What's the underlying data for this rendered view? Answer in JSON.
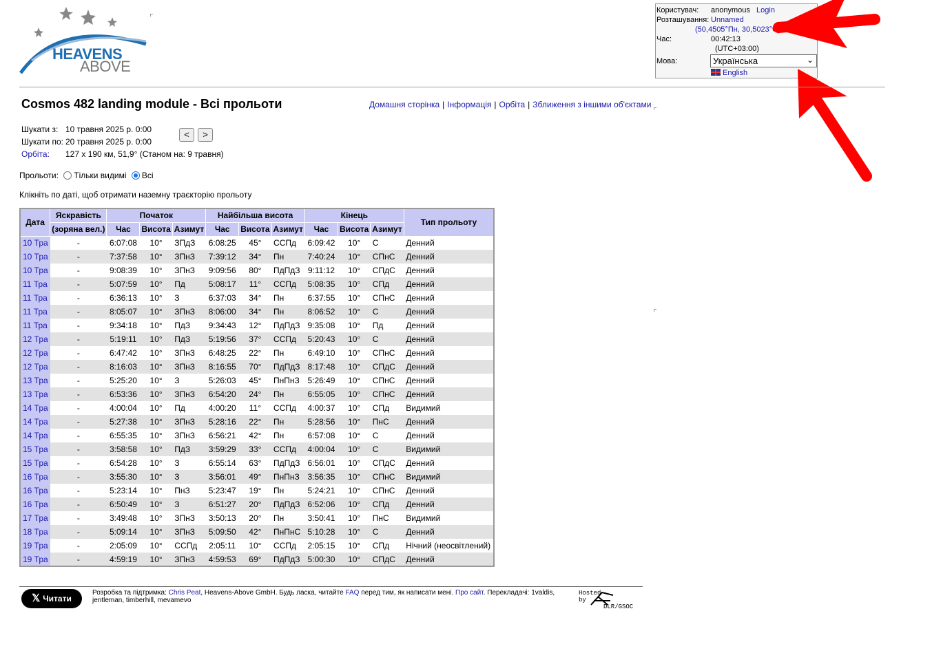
{
  "logo": {
    "line1": "HEAVENS",
    "line2": "ABOVE"
  },
  "userbox": {
    "user_label": "Користувач:",
    "user_value": "anonymous",
    "login_link": "Login",
    "location_label": "Розташування:",
    "location_name": "Unnamed",
    "location_coords": "(50,4505°Пн, 30,5023°С)",
    "time_label": "Час:",
    "time_value": "00:42:13",
    "timezone": "(UTC+03:00)",
    "language_label": "Мова:",
    "language_selected": "Українська",
    "english_link": "English"
  },
  "title": "Cosmos 482 landing module - Всі прольоти",
  "topnav": {
    "home": "Домашня сторінка",
    "info": "Інформація",
    "orbit": "Орбіта",
    "close": "Зближення з іншими об'єктами"
  },
  "params": {
    "from_label": "Шукати з:",
    "from_value": "10 травня 2025 р. 0:00",
    "to_label": "Шукати по:",
    "to_value": "20 травня 2025 р. 0:00",
    "orbit_label": "Орбіта:",
    "orbit_value": "127 x 190 км, 51,9° (Станом на: 9 травня)",
    "prev": "<",
    "next": ">"
  },
  "filter": {
    "label": "Прольоти:",
    "visible_only": "Тільки видимі",
    "all": "Всі"
  },
  "hint": "Клікніть по даті, щоб отримати наземну траєкторію прольоту",
  "table": {
    "headers": {
      "date": "Дата",
      "brightness": "Яскравість",
      "brightness_sub": "(зоряна вел.)",
      "start": "Початок",
      "highest": "Найбільша висота",
      "end": "Кінець",
      "type": "Тип прольоту",
      "time": "Час",
      "alt": "Висота",
      "az": "Азимут"
    },
    "rows": [
      [
        "10 Тра",
        "-",
        "6:07:08",
        "10°",
        "ЗПдЗ",
        "6:08:25",
        "45°",
        "ССПд",
        "6:09:42",
        "10°",
        "С",
        "Денний"
      ],
      [
        "10 Тра",
        "-",
        "7:37:58",
        "10°",
        "ЗПнЗ",
        "7:39:12",
        "34°",
        "Пн",
        "7:40:24",
        "10°",
        "СПнС",
        "Денний"
      ],
      [
        "10 Тра",
        "-",
        "9:08:39",
        "10°",
        "ЗПнЗ",
        "9:09:56",
        "80°",
        "ПдПдЗ",
        "9:11:12",
        "10°",
        "СПдС",
        "Денний"
      ],
      [
        "11 Тра",
        "-",
        "5:07:59",
        "10°",
        "Пд",
        "5:08:17",
        "11°",
        "ССПд",
        "5:08:35",
        "10°",
        "СПд",
        "Денний"
      ],
      [
        "11 Тра",
        "-",
        "6:36:13",
        "10°",
        "З",
        "6:37:03",
        "34°",
        "Пн",
        "6:37:55",
        "10°",
        "СПнС",
        "Денний"
      ],
      [
        "11 Тра",
        "-",
        "8:05:07",
        "10°",
        "ЗПнЗ",
        "8:06:00",
        "34°",
        "Пн",
        "8:06:52",
        "10°",
        "С",
        "Денний"
      ],
      [
        "11 Тра",
        "-",
        "9:34:18",
        "10°",
        "ПдЗ",
        "9:34:43",
        "12°",
        "ПдПдЗ",
        "9:35:08",
        "10°",
        "Пд",
        "Денний"
      ],
      [
        "12 Тра",
        "-",
        "5:19:11",
        "10°",
        "ПдЗ",
        "5:19:56",
        "37°",
        "ССПд",
        "5:20:43",
        "10°",
        "С",
        "Денний"
      ],
      [
        "12 Тра",
        "-",
        "6:47:42",
        "10°",
        "ЗПнЗ",
        "6:48:25",
        "22°",
        "Пн",
        "6:49:10",
        "10°",
        "СПнС",
        "Денний"
      ],
      [
        "12 Тра",
        "-",
        "8:16:03",
        "10°",
        "ЗПнЗ",
        "8:16:55",
        "70°",
        "ПдПдЗ",
        "8:17:48",
        "10°",
        "СПдС",
        "Денний"
      ],
      [
        "13 Тра",
        "-",
        "5:25:20",
        "10°",
        "З",
        "5:26:03",
        "45°",
        "ПнПнЗ",
        "5:26:49",
        "10°",
        "СПнС",
        "Денний"
      ],
      [
        "13 Тра",
        "-",
        "6:53:36",
        "10°",
        "ЗПнЗ",
        "6:54:20",
        "24°",
        "Пн",
        "6:55:05",
        "10°",
        "СПнС",
        "Денний"
      ],
      [
        "14 Тра",
        "-",
        "4:00:04",
        "10°",
        "Пд",
        "4:00:20",
        "11°",
        "ССПд",
        "4:00:37",
        "10°",
        "СПд",
        "Видимий"
      ],
      [
        "14 Тра",
        "-",
        "5:27:38",
        "10°",
        "ЗПнЗ",
        "5:28:16",
        "22°",
        "Пн",
        "5:28:56",
        "10°",
        "ПнС",
        "Денний"
      ],
      [
        "14 Тра",
        "-",
        "6:55:35",
        "10°",
        "ЗПнЗ",
        "6:56:21",
        "42°",
        "Пн",
        "6:57:08",
        "10°",
        "С",
        "Денний"
      ],
      [
        "15 Тра",
        "-",
        "3:58:58",
        "10°",
        "ПдЗ",
        "3:59:29",
        "33°",
        "ССПд",
        "4:00:04",
        "10°",
        "С",
        "Видимий"
      ],
      [
        "15 Тра",
        "-",
        "6:54:28",
        "10°",
        "З",
        "6:55:14",
        "63°",
        "ПдПдЗ",
        "6:56:01",
        "10°",
        "СПдС",
        "Денний"
      ],
      [
        "16 Тра",
        "-",
        "3:55:30",
        "10°",
        "З",
        "3:56:01",
        "49°",
        "ПнПнЗ",
        "3:56:35",
        "10°",
        "СПнС",
        "Видимий"
      ],
      [
        "16 Тра",
        "-",
        "5:23:14",
        "10°",
        "ПнЗ",
        "5:23:47",
        "19°",
        "Пн",
        "5:24:21",
        "10°",
        "СПнС",
        "Денний"
      ],
      [
        "16 Тра",
        "-",
        "6:50:49",
        "10°",
        "З",
        "6:51:27",
        "20°",
        "ПдПдЗ",
        "6:52:06",
        "10°",
        "СПд",
        "Денний"
      ],
      [
        "17 Тра",
        "-",
        "3:49:48",
        "10°",
        "ЗПнЗ",
        "3:50:13",
        "20°",
        "Пн",
        "3:50:41",
        "10°",
        "ПнС",
        "Видимий"
      ],
      [
        "18 Тра",
        "-",
        "5:09:14",
        "10°",
        "ЗПнЗ",
        "5:09:50",
        "42°",
        "ПнПнС",
        "5:10:28",
        "10°",
        "С",
        "Денний"
      ],
      [
        "19 Тра",
        "-",
        "2:05:09",
        "10°",
        "ССПд",
        "2:05:11",
        "10°",
        "ССПд",
        "2:05:15",
        "10°",
        "СПд",
        "Нічний (неосвітлений)"
      ],
      [
        "19 Тра",
        "-",
        "4:59:19",
        "10°",
        "ЗПнЗ",
        "4:59:53",
        "69°",
        "ПдПдЗ",
        "5:00:30",
        "10°",
        "СПдС",
        "Денний"
      ]
    ]
  },
  "footer": {
    "tweet_label": "Читати",
    "text_1": "Розробка та підтримка: ",
    "author": "Chris Peat",
    "text_2": ", Heavens-Above GmbH. Будь ласка, читайте ",
    "faq": "FAQ",
    "text_3": " перед тим, як написати мені. ",
    "about": "Про сайт",
    "text_4": ". Перекладачі: 1valdis, jentleman, timberhill, mevamevo",
    "hosted_line1": "Hosted",
    "hosted_line2": "by",
    "hosted_org": "DLR/GSOC"
  },
  "colors": {
    "table_header": "#c8c8f4",
    "row_alt": "#e2e2e2",
    "link": "#1a1aaa",
    "arrow": "#ff0000"
  }
}
